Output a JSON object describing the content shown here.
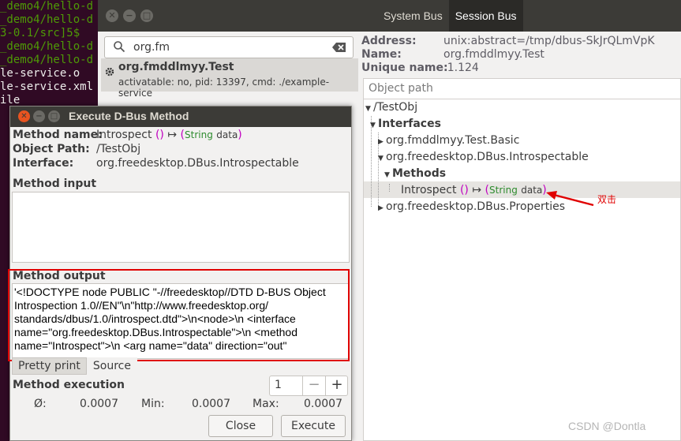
{
  "terminal": {
    "lines": [
      {
        "text": "_demo4/hello-d",
        "color": "green"
      },
      {
        "text": "_demo4/hello-d",
        "color": "green"
      },
      {
        "text": "3-0.1/src]5$",
        "color": "green"
      },
      {
        "text": "_demo4/hello-d",
        "color": "green"
      },
      {
        "text": "_demo4/hello-d",
        "color": "green"
      },
      {
        "text": "le-service.o",
        "color": "white"
      },
      {
        "text": "le-service.xml",
        "color": "white"
      },
      {
        "text": "ile",
        "color": "white"
      }
    ]
  },
  "main": {
    "bus_tabs": [
      "System Bus",
      "Session Bus"
    ],
    "active_bus_tab": "Session Bus",
    "search": {
      "value": "org.fm"
    },
    "service": {
      "name": "org.fmddlmyy.Test",
      "detail": "activatable: no, pid: 13397, cmd: ./example-service"
    },
    "info": {
      "address_label": "Address:",
      "address_value": "unix:abstract=/tmp/dbus-SkJrQLmVpK",
      "name_label": "Name:",
      "name_value": "org.fmddlmyy.Test",
      "unique_label": "Unique name:",
      "unique_value": ":1.124"
    },
    "tree": {
      "header": "Object path",
      "root": "/TestObj",
      "interfaces_label": "Interfaces",
      "iface_basic": "org.fmddlmyy.Test.Basic",
      "iface_introspectable": "org.freedesktop.DBus.Introspectable",
      "methods_label": "Methods",
      "method_name": "Introspect",
      "method_paren": "()",
      "method_arrow": "↦",
      "method_open": "(",
      "method_type": "String",
      "method_arg": "data",
      "method_close": ")",
      "iface_properties": "org.freedesktop.DBus.Properties"
    },
    "annotation": "双击",
    "watermark": "CSDN @Dontla"
  },
  "dialog": {
    "title": "Execute D-Bus Method",
    "method_name_label": "Method name:",
    "method_name": "Introspect",
    "method_paren": "()",
    "method_arrow": "↦",
    "method_open": "(",
    "method_type": "String",
    "method_arg": "data",
    "method_close": ")",
    "object_path_label": "Object Path:",
    "object_path": "/TestObj",
    "interface_label": "Interface:",
    "interface": "org.freedesktop.DBus.Introspectable",
    "method_input_label": "Method input",
    "method_output_label": "Method output",
    "output_lines": [
      "'<!DOCTYPE node PUBLIC \"-//freedesktop//DTD D-BUS Object",
      "Introspection 1.0//EN\"\\n\"http://www.freedesktop.org/",
      "standards/dbus/1.0/introspect.dtd\">\\n<node>\\n  <interface",
      "name=\"org.freedesktop.DBus.Introspectable\">\\n    <method",
      "name=\"Introspect\">\\n      <arg name=\"data\" direction=\"out\""
    ],
    "pretty_print_label": "Pretty print",
    "source_label": "Source",
    "method_execution_label": "Method execution",
    "spin_value": "1",
    "spin_minus": "−",
    "spin_plus": "+",
    "avg_label": "Ø:",
    "avg_value": "0.0007",
    "min_label": "Min:",
    "min_value": "0.0007",
    "max_label": "Max:",
    "max_value": "0.0007",
    "close_label": "Close",
    "execute_label": "Execute"
  },
  "colors": {
    "terminal_bg": "#300a24",
    "titlebar": "#3c3b37",
    "close_orange": "#e95420",
    "highlight_red": "#e00000"
  }
}
